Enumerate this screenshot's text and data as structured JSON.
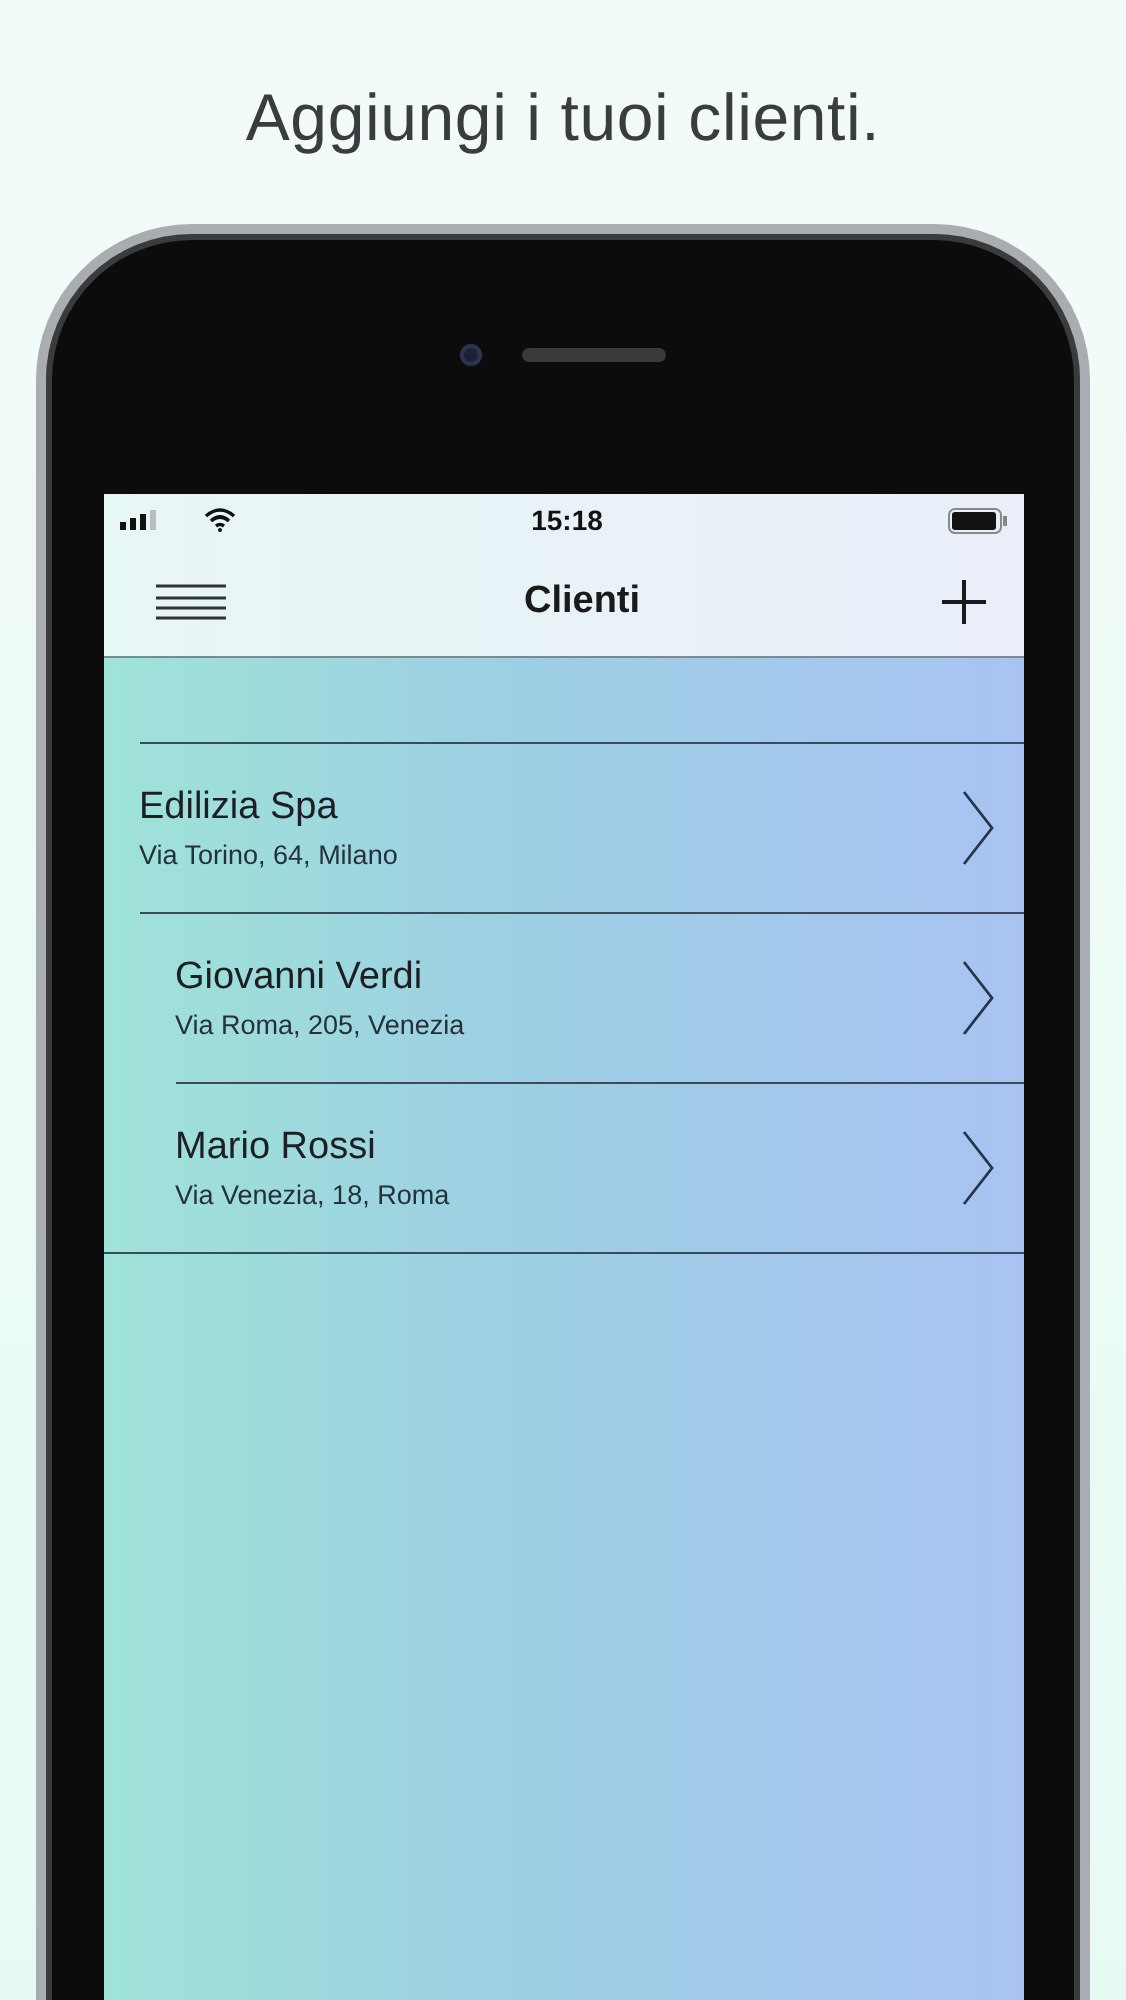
{
  "headline": "Aggiungi i tuoi clienti.",
  "status_bar": {
    "time": "15:18"
  },
  "nav": {
    "title": "Clienti"
  },
  "clients": [
    {
      "name": "Edilizia Spa",
      "address": "Via Torino, 64, Milano"
    },
    {
      "name": "Giovanni Verdi",
      "address": "Via Roma, 205, Venezia"
    },
    {
      "name": "Mario Rossi",
      "address": "Via Venezia, 18, Roma"
    }
  ]
}
